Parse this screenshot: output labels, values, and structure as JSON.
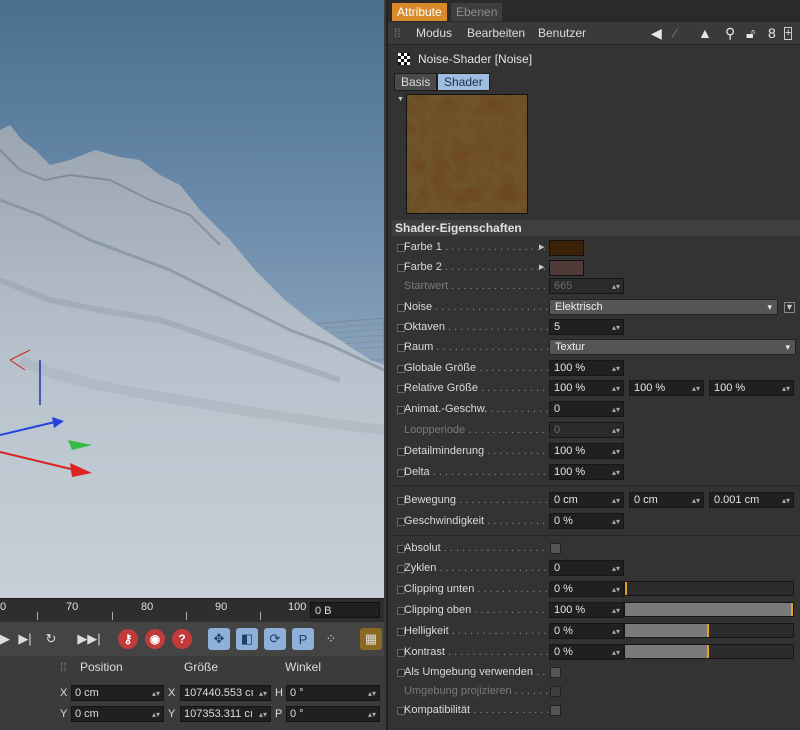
{
  "viewport": {
    "name": "3d-viewport"
  },
  "timeline": {
    "ticks": [
      "0",
      "70",
      "80",
      "90",
      "100"
    ],
    "frame_value": "0 B"
  },
  "coord_manager": {
    "headers": {
      "position": "Position",
      "size": "Größe",
      "angle": "Winkel"
    },
    "rows": [
      {
        "axis": "X",
        "pos": "0 cm",
        "size_axis": "X",
        "size": "107440.553 cı",
        "ang_axis": "H",
        "angle": "0 °"
      },
      {
        "axis": "Y",
        "pos": "0 cm",
        "size_axis": "Y",
        "size": "107353.311 cı",
        "ang_axis": "P",
        "angle": "0 °"
      }
    ]
  },
  "attr": {
    "panel_tabs": [
      "Attribute",
      "Ebenen"
    ],
    "menu": [
      "Modus",
      "Bearbeiten",
      "Benutzer"
    ],
    "object_title": "Noise-Shader [Noise]",
    "sub_tabs": [
      "Basis",
      "Shader"
    ],
    "section": "Shader-Eigenschaften",
    "rows": {
      "farbe1": {
        "label": "Farbe 1",
        "color": "#3a2108"
      },
      "farbe2": {
        "label": "Farbe 2",
        "color": "#4e3a36"
      },
      "startwert": {
        "label": "Startwert",
        "value": "665"
      },
      "noise": {
        "label": "Noise",
        "value": "Elektrisch"
      },
      "oktaven": {
        "label": "Oktaven",
        "value": "5"
      },
      "raum": {
        "label": "Raum",
        "value": "Textur"
      },
      "globale": {
        "label": "Globale Größe",
        "value": "100 %"
      },
      "relative": {
        "label": "Relative Größe",
        "values": [
          "100 %",
          "100 %",
          "100 %"
        ]
      },
      "animat": {
        "label": "Animat.-Geschw.",
        "value": "0"
      },
      "loop": {
        "label": "Loopperiode",
        "value": "0"
      },
      "detail": {
        "label": "Detailminderung",
        "value": "100 %"
      },
      "delta": {
        "label": "Delta",
        "value": "100 %"
      },
      "bewegung": {
        "label": "Bewegung",
        "values": [
          "0 cm",
          "0 cm",
          "0.001 cm"
        ]
      },
      "geschw": {
        "label": "Geschwindigkeit",
        "value": "0 %"
      },
      "absolut": {
        "label": "Absolut"
      },
      "zyklen": {
        "label": "Zyklen",
        "value": "0"
      },
      "clip_unten": {
        "label": "Clipping unten",
        "value": "0 %",
        "level": 0
      },
      "clip_oben": {
        "label": "Clipping oben",
        "value": "100 %",
        "level": 1
      },
      "helligkeit": {
        "label": "Helligkeit",
        "value": "0 %",
        "level": 0.5
      },
      "kontrast": {
        "label": "Kontrast",
        "value": "0 %",
        "level": 0.5
      },
      "umgebung": {
        "label": "Als Umgebung verwenden"
      },
      "projizieren": {
        "label": "Umgebung projizieren"
      },
      "kompat": {
        "label": "Kompatibilität"
      }
    }
  }
}
